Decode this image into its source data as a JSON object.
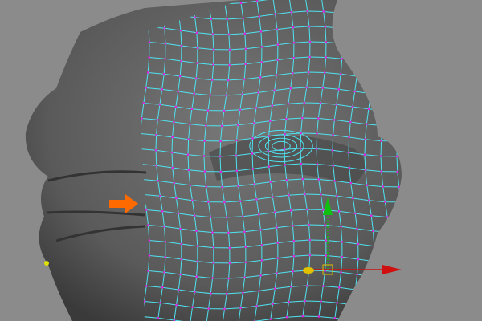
{
  "viewport": {
    "background_color": "#8b8b8b",
    "mesh_color": "#5e5e5e",
    "wire_color": "#4fe3f0",
    "vertex_color": "#e020e0"
  },
  "annotation": {
    "icon": "arrow-right-icon",
    "color": "#ff6a00"
  },
  "manipulator": {
    "icon": "move-tool-manipulator-icon",
    "x_axis_color": "#d01010",
    "y_axis_color": "#10c010",
    "center_color": "#e0c000"
  }
}
